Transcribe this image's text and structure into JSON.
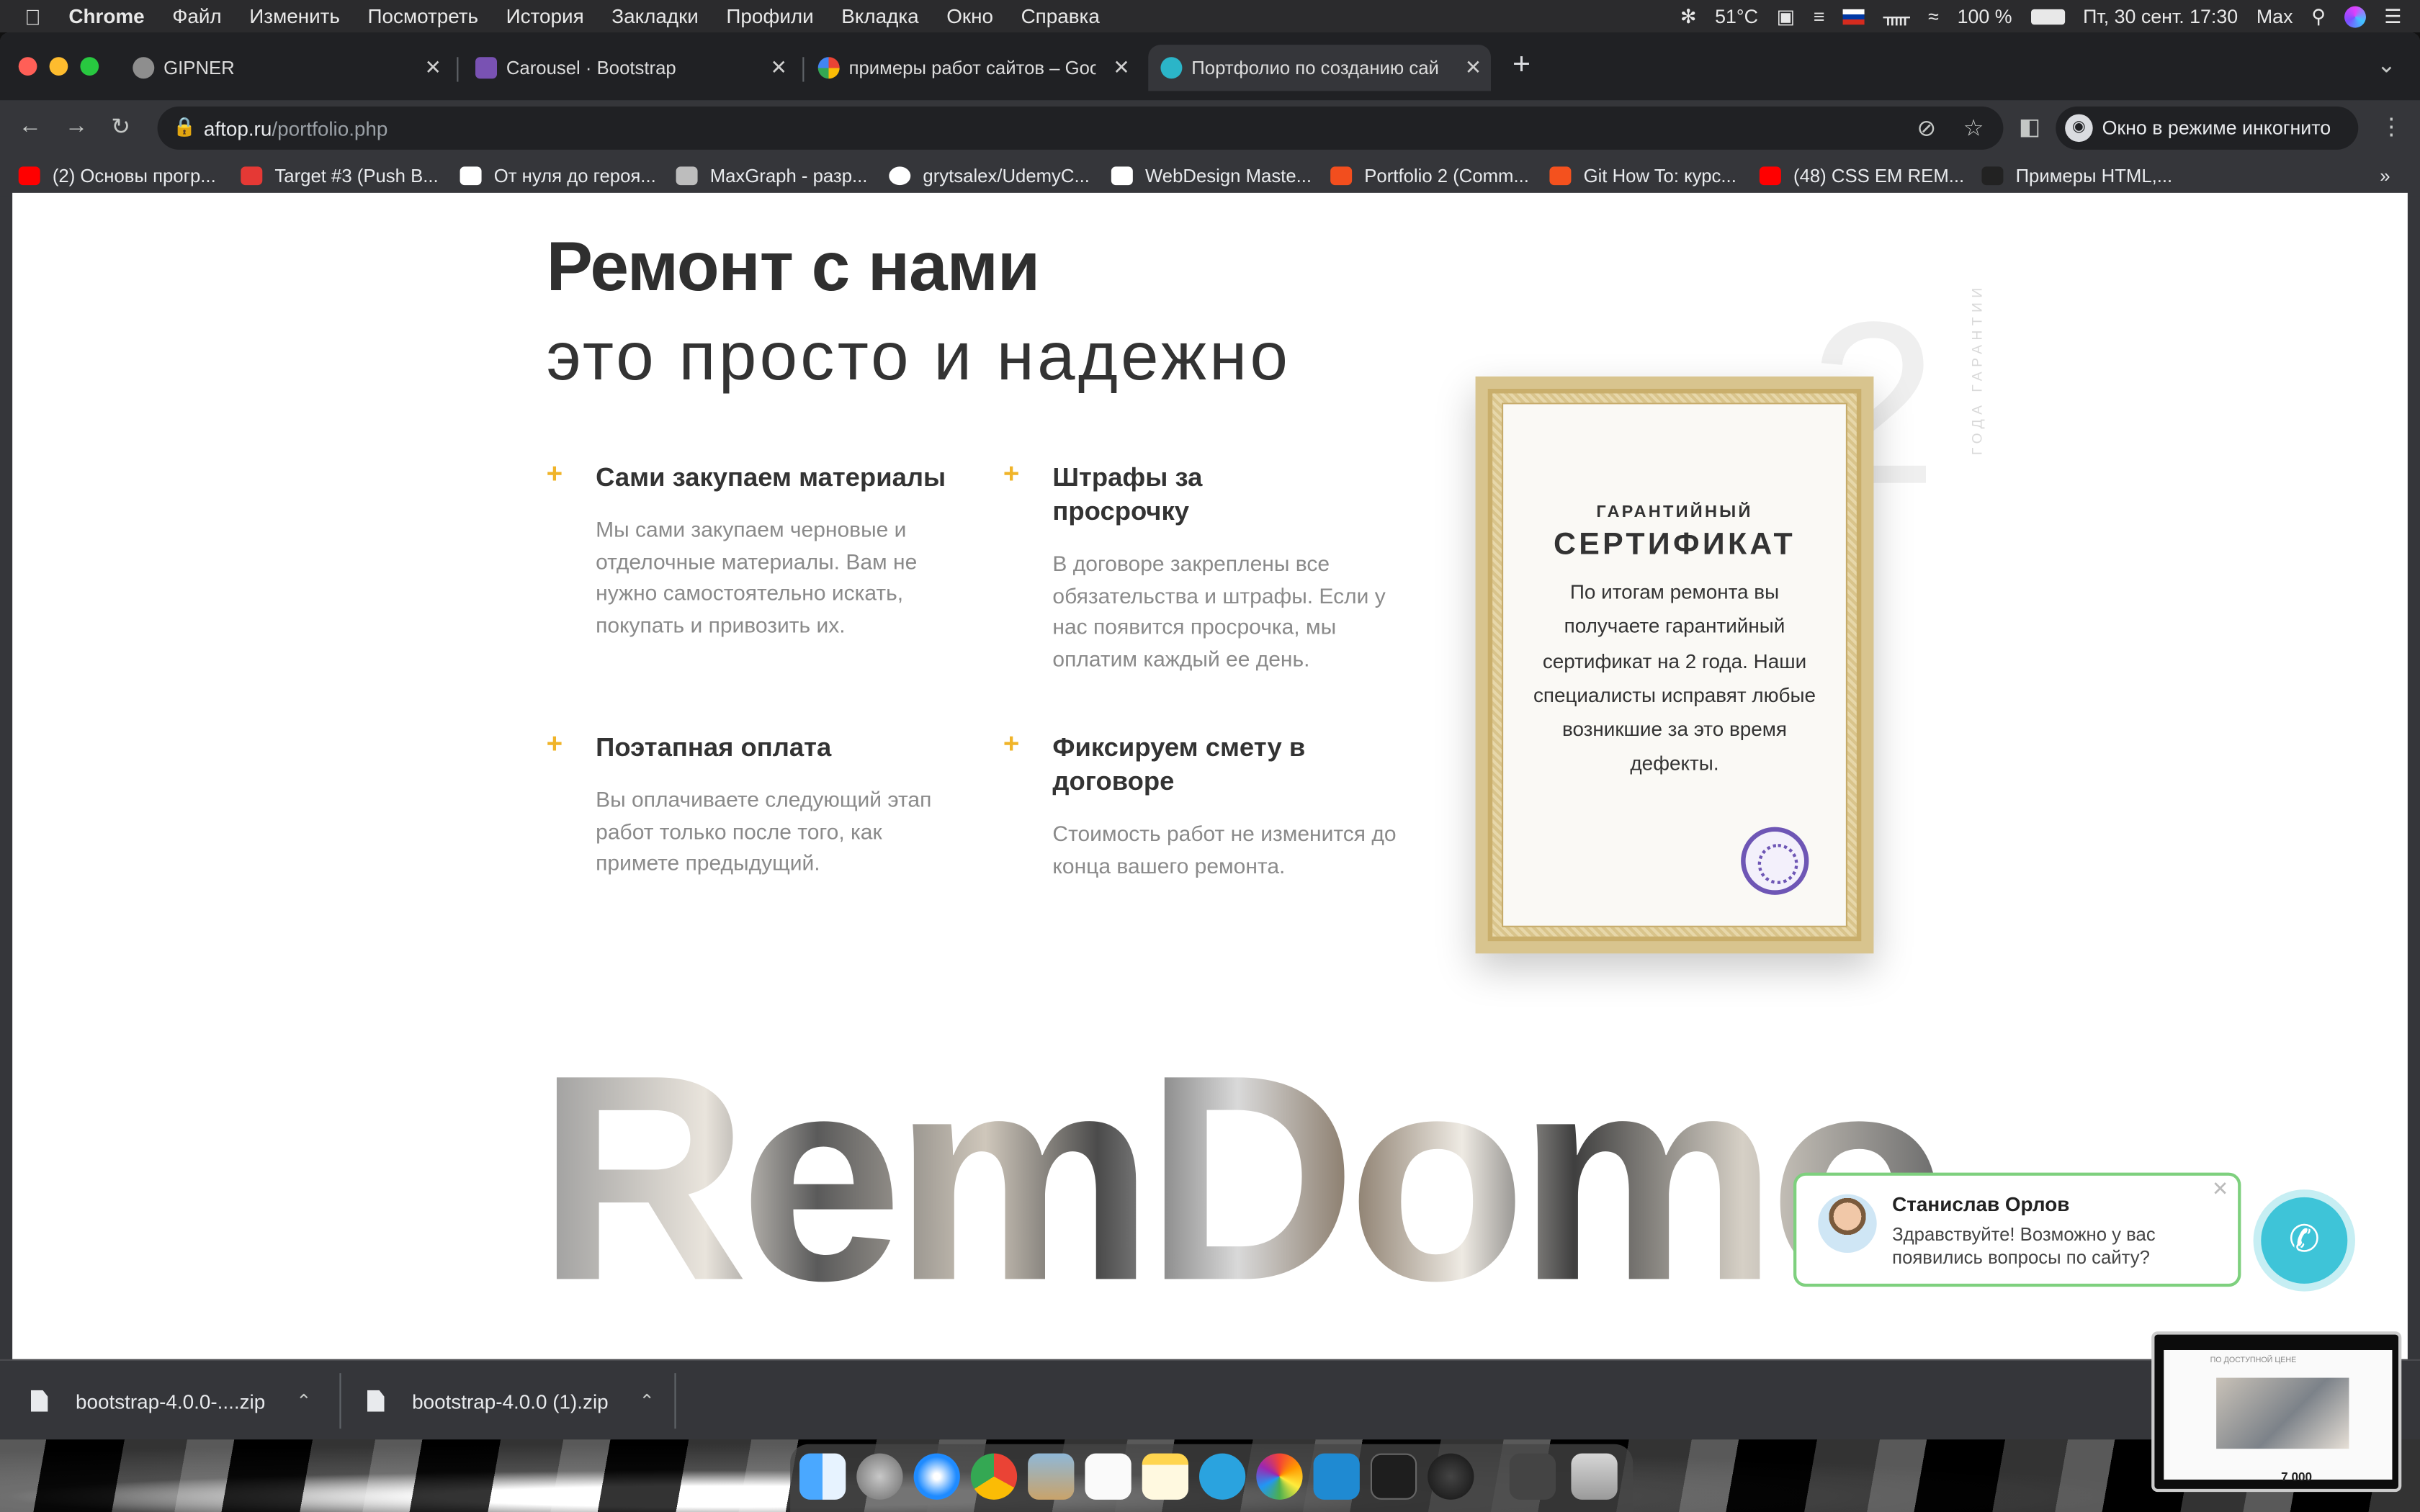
{
  "menubar": {
    "app": "Chrome",
    "items": [
      "Файл",
      "Изменить",
      "Посмотреть",
      "История",
      "Закладки",
      "Профили",
      "Вкладка",
      "Окно",
      "Справка"
    ],
    "temperature": "51°C",
    "battery": "100 %",
    "datetime": "Пт, 30 сент.  17:30",
    "user": "Max"
  },
  "tabs": [
    {
      "label": "GIPNER",
      "favicon_color": "#8e8e8e"
    },
    {
      "label": "Carousel · Bootstrap",
      "favicon_color": "#7952b3"
    },
    {
      "label": "примеры работ сайтов – Goo",
      "favicon_color": "#4285f4"
    },
    {
      "label": "Портфолио по созданию сай",
      "favicon_color": "#2bb5c8"
    }
  ],
  "omnibox": {
    "host": "aftop.ru",
    "path": "/portfolio.php"
  },
  "incognito_label": "Окно в режиме инкогнито",
  "bookmarks": [
    {
      "label": "(2) Основы прогр...",
      "color": "#ff0000"
    },
    {
      "label": "Target #3 (Push B...",
      "color": "#e53935"
    },
    {
      "label": "От нуля до героя...",
      "color": "#ffffff"
    },
    {
      "label": "MaxGraph - разр...",
      "color": "#bdbdbd"
    },
    {
      "label": "grytsalex/UdemyC...",
      "color": "#ffffff"
    },
    {
      "label": "WebDesign Maste...",
      "color": "#ffffff"
    },
    {
      "label": "Portfolio 2 (Comm...",
      "color": "#f24e1e"
    },
    {
      "label": "Git How To: курс...",
      "color": "#f4511e"
    },
    {
      "label": "(48) CSS EM REM...",
      "color": "#ff0000"
    },
    {
      "label": "Примеры HTML,...",
      "color": "#333333"
    }
  ],
  "page": {
    "heading_bold": "Ремонт с нами",
    "heading_light": "это просто и надежно",
    "features": [
      {
        "title": "Сами закупаем материалы",
        "desc": "Мы сами закупаем черновые и отделочные материалы. Вам не нужно самостоятельно искать, покупать и привозить их."
      },
      {
        "title": "Штрафы за просрочку",
        "desc": "В договоре закреплены все обязательства и штрафы. Если у нас появится просрочка, мы оплатим каждый ее день."
      },
      {
        "title": "Поэтапная оплата",
        "desc": "Вы оплачиваете следующий этап работ только после того, как примете предыдущий."
      },
      {
        "title": "Фиксируем смету в договоре",
        "desc": "Стоимость работ не изменится до конца вашего ремонта."
      }
    ],
    "certificate": {
      "kicker": "ГАРАНТИЙНЫЙ",
      "title": "СЕРТИФИКАТ",
      "text": "По итогам ремонта вы получаете гарантийный сертификат на 2 года. Наши специалисты исправят любые возникшие за это время дефекты."
    },
    "years_number": "2",
    "years_label": "ГОДА ГАРАНТИИ",
    "brand": "RemDomo"
  },
  "chat": {
    "name": "Станислав Орлов",
    "message": "Здравствуйте! Возможно у вас появились вопросы по сайту?"
  },
  "downloads": [
    {
      "name": "bootstrap-4.0.0-....zip"
    },
    {
      "name": "bootstrap-4.0.0 (1).zip"
    }
  ],
  "thumbnail": {
    "caption": "ПО ДОСТУПНОЙ ЦЕНЕ",
    "price": "7 000"
  }
}
